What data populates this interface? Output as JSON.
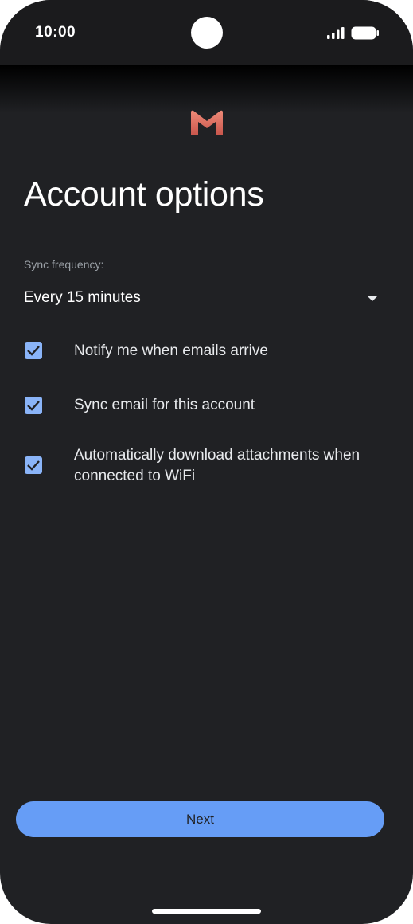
{
  "status_bar": {
    "time": "10:00",
    "icons": [
      "signal-icon",
      "battery-icon"
    ]
  },
  "brand": {
    "logo_icon": "gmail-m-logo",
    "logo_color": "#e8776b"
  },
  "page": {
    "title": "Account options"
  },
  "sync": {
    "label": "Sync frequency:",
    "selected": "Every 15 minutes",
    "icon": "dropdown-arrow-icon"
  },
  "options": [
    {
      "label": "Notify me when emails arrive",
      "checked": true
    },
    {
      "label": "Sync email for this account",
      "checked": true
    },
    {
      "label": "Automatically download attachments when connected to WiFi",
      "checked": true
    }
  ],
  "actions": {
    "next_label": "Next"
  },
  "colors": {
    "background": "#202124",
    "accent": "#669df6",
    "checkbox": "#8ab4f8",
    "text_primary": "#ffffff",
    "text_secondary": "#9aa0a6"
  }
}
